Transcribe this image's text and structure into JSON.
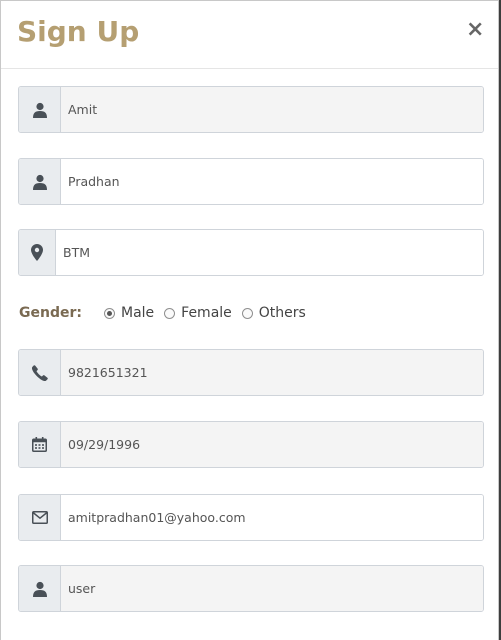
{
  "modal": {
    "title": "Sign Up",
    "close_label": "×"
  },
  "form": {
    "first_name": {
      "value": "Amit",
      "icon": "user-icon"
    },
    "last_name": {
      "value": "Pradhan",
      "icon": "user-icon"
    },
    "address": {
      "value": "BTM",
      "icon": "map-marker-icon"
    },
    "gender": {
      "label": "Gender:",
      "options": [
        "Male",
        "Female",
        "Others"
      ],
      "selected": "Male"
    },
    "phone": {
      "value": "9821651321",
      "icon": "phone-icon"
    },
    "dob": {
      "value": "09/29/1996",
      "icon": "calendar-icon"
    },
    "email": {
      "value": "amitpradhan01@yahoo.com",
      "icon": "envelope-icon"
    },
    "username": {
      "value": "user",
      "icon": "user-icon"
    }
  },
  "colors": {
    "title": "#b59f72",
    "gender_label": "#7a6a52",
    "icon": "#495057",
    "addon_bg": "#e9ecef"
  }
}
